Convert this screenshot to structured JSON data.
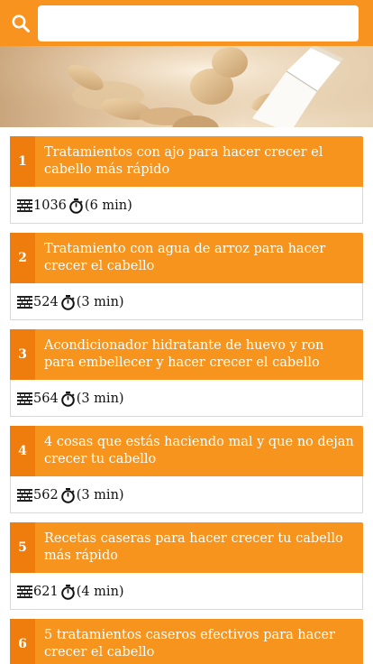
{
  "search": {
    "placeholder": "",
    "value": "",
    "icon": "search-icon"
  },
  "colors": {
    "accent": "#f7931e",
    "number_bg": "#ee7d0e",
    "card_header": "#f7941d",
    "text_light": "#ffffff"
  },
  "articles": [
    {
      "number": "1",
      "title": "Tratamientos con ajo para hacer crecer el cabello más rápido",
      "views": "1036",
      "read_time": "(6 min)"
    },
    {
      "number": "2",
      "title": "Tratamiento con agua de arroz para hacer crecer el cabello",
      "views": "524",
      "read_time": "(3 min)"
    },
    {
      "number": "3",
      "title": "Acondicionador hidratante de huevo y ron para embellecer y hacer crecer el cabello",
      "views": "564",
      "read_time": "(3 min)"
    },
    {
      "number": "4",
      "title": "4 cosas que estás haciendo mal y que no dejan crecer tu cabello",
      "views": "562",
      "read_time": "(3 min)"
    },
    {
      "number": "5",
      "title": "Recetas caseras para hacer crecer tu cabello más rápido",
      "views": "621",
      "read_time": "(4 min)"
    },
    {
      "number": "6",
      "title": "5 tratamientos caseros efectivos para hacer crecer el cabello",
      "views": "",
      "read_time": ""
    }
  ]
}
